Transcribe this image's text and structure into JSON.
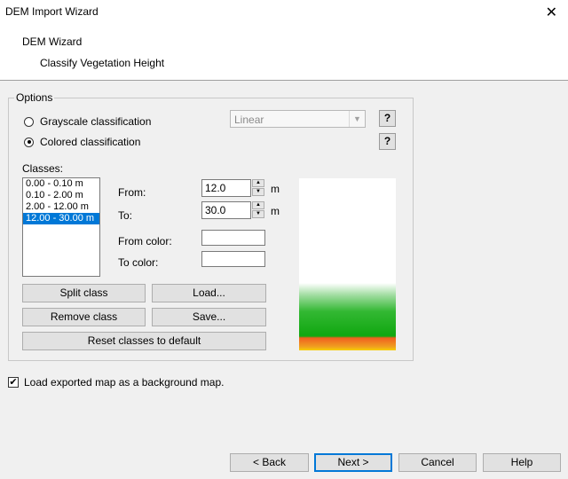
{
  "window": {
    "title": "DEM Import Wizard"
  },
  "header": {
    "wizard": "DEM Wizard",
    "step": "Classify Vegetation Height"
  },
  "options": {
    "legend": "Options",
    "grayscale_label": "Grayscale classification",
    "colored_label": "Colored classification",
    "selected": "colored",
    "scale_combo": "Linear",
    "help_glyph": "?"
  },
  "classes": {
    "label": "Classes:",
    "items": [
      "0.00 - 0.10 m",
      "0.10 - 2.00 m",
      "2.00 - 12.00 m",
      "12.00 - 30.00 m"
    ],
    "selected_index": 3
  },
  "range": {
    "from_label": "From:",
    "from_value": "12.0",
    "to_label": "To:",
    "to_value": "30.0",
    "unit": "m",
    "from_color_label": "From color:",
    "to_color_label": "To color:"
  },
  "buttons": {
    "split": "Split class",
    "load": "Load...",
    "remove": "Remove class",
    "save": "Save...",
    "reset": "Reset classes to default"
  },
  "background_checkbox": {
    "label": "Load exported map as a background map.",
    "checked": true
  },
  "footer": {
    "back": "< Back",
    "next": "Next >",
    "cancel": "Cancel",
    "help": "Help"
  }
}
